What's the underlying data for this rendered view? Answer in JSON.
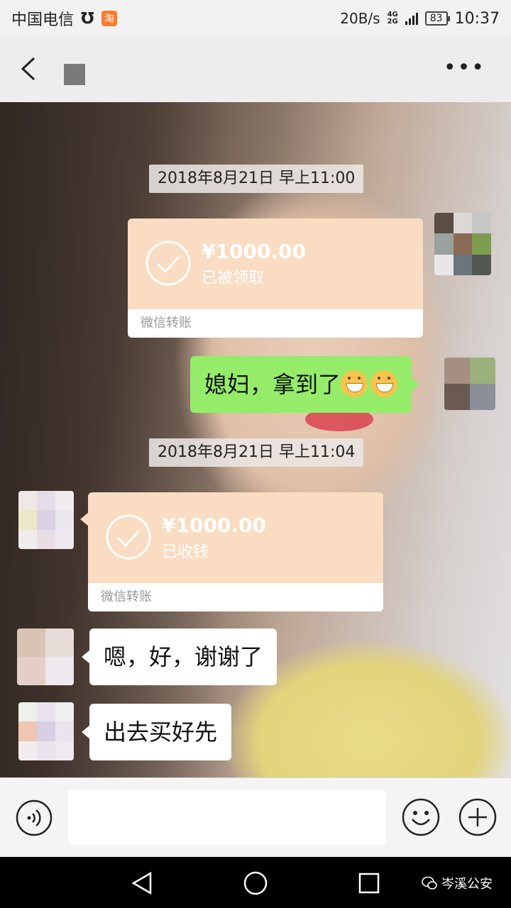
{
  "status_bar": {
    "carrier": "中国电信",
    "taobao_glyph": "淘",
    "net_speed": "20B/s",
    "signal_top": "4G",
    "signal_bottom": "2G",
    "battery": "83",
    "time": "10:37"
  },
  "title_bar": {
    "back_icon": "chevron-left-icon",
    "more_label": "•••"
  },
  "messages": {
    "ts1": "2018年8月21日 早上11:00",
    "transfer1": {
      "amount": "¥1000.00",
      "status": "已被领取",
      "footer": "微信转账"
    },
    "outgoing1": {
      "text": "媳妇，拿到了",
      "emoji_count": 2
    },
    "ts2": "2018年8月21日 早上11:04",
    "transfer2": {
      "amount": "¥1000.00",
      "status": "已收钱",
      "footer": "微信转账"
    },
    "incoming1": "嗯，好，谢谢了",
    "incoming2": "出去买好先"
  },
  "input_bar": {
    "text_value": "",
    "voice_icon": "voice-icon",
    "emoji_icon": "smiley-icon",
    "plus_icon": "plus-icon"
  },
  "nav_bar": {
    "watermark": "岑溪公安"
  },
  "colors": {
    "outgoing_bubble": "#95ec69",
    "transfer_card": "#f9dcc1",
    "incoming_bubble": "#ffffff"
  }
}
